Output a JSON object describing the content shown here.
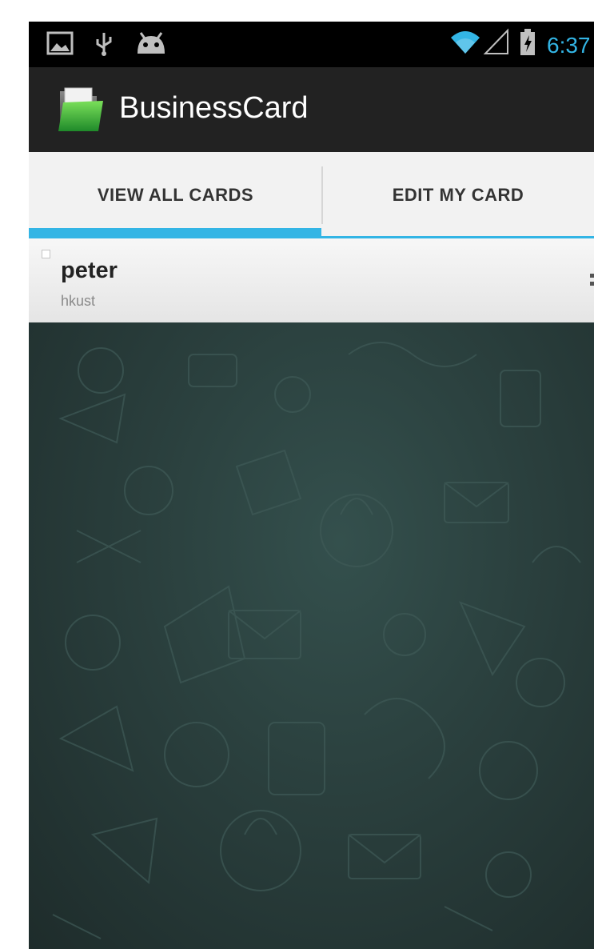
{
  "status_bar": {
    "time": "6:37",
    "icons": [
      "image-notification-icon",
      "usb-icon",
      "android-debug-icon",
      "wifi-icon",
      "signal-icon",
      "battery-charging-icon"
    ]
  },
  "action_bar": {
    "app_icon": "folder-card-icon",
    "title": "BusinessCard"
  },
  "tabs": [
    {
      "label": "VIEW ALL CARDS",
      "selected": true
    },
    {
      "label": "EDIT MY CARD",
      "selected": false
    }
  ],
  "colors": {
    "accent": "#33b5e5",
    "status_bar": "#000000",
    "action_bar": "#222222",
    "tab_bar": "#f2f2f2",
    "wallpaper": "#2a3f3d"
  },
  "cards": [
    {
      "name": "peter",
      "organization": "hkust"
    }
  ],
  "background": {
    "pattern_icons": "doodle-wallpaper"
  }
}
